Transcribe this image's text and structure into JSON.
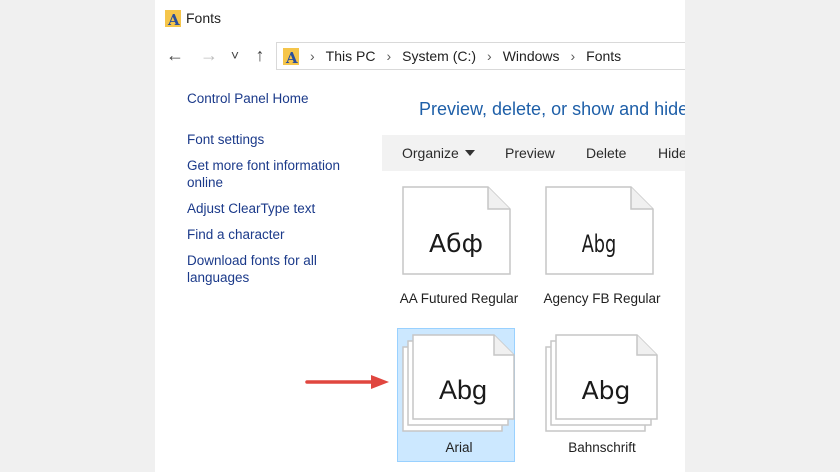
{
  "window": {
    "title": "Fonts"
  },
  "nav": {
    "back_glyph": "←",
    "forward_glyph": "→",
    "recent_glyph": "˅",
    "up_glyph": "↑",
    "breadcrumb": [
      "This PC",
      "System (C:)",
      "Windows",
      "Fonts"
    ],
    "separator": "›"
  },
  "sidebar": {
    "items": [
      {
        "label": "Control Panel Home"
      },
      {
        "label": "Font settings"
      },
      {
        "label": "Get more font information online"
      },
      {
        "label": "Adjust ClearType text"
      },
      {
        "label": "Find a character"
      },
      {
        "label": "Download fonts for all languages"
      }
    ]
  },
  "main": {
    "heading": "Preview, delete, or show and hide",
    "toolbar": {
      "organize": "Organize",
      "preview": "Preview",
      "delete": "Delete",
      "hide": "Hide"
    },
    "fonts": [
      {
        "preview": "Абф",
        "name": "AA Futured Regular",
        "stacked": false,
        "selected": false
      },
      {
        "preview": "Abg",
        "name": "Agency FB Regular",
        "stacked": false,
        "selected": false
      },
      {
        "preview": "Abg",
        "name": "Arial",
        "stacked": true,
        "selected": true
      },
      {
        "preview": "Abg",
        "name": "Bahnschrift",
        "stacked": true,
        "selected": false
      }
    ]
  },
  "colors": {
    "link": "#1b3a8a",
    "heading": "#1e5fa8",
    "selection": "#cce8ff",
    "arrow": "#e0463f",
    "folder_icon": "#f5c54a"
  },
  "icons": [
    "fonts-folder-icon",
    "back-arrow-icon",
    "forward-arrow-icon",
    "recent-dropdown-icon",
    "up-arrow-icon",
    "red-pointer-arrow"
  ]
}
